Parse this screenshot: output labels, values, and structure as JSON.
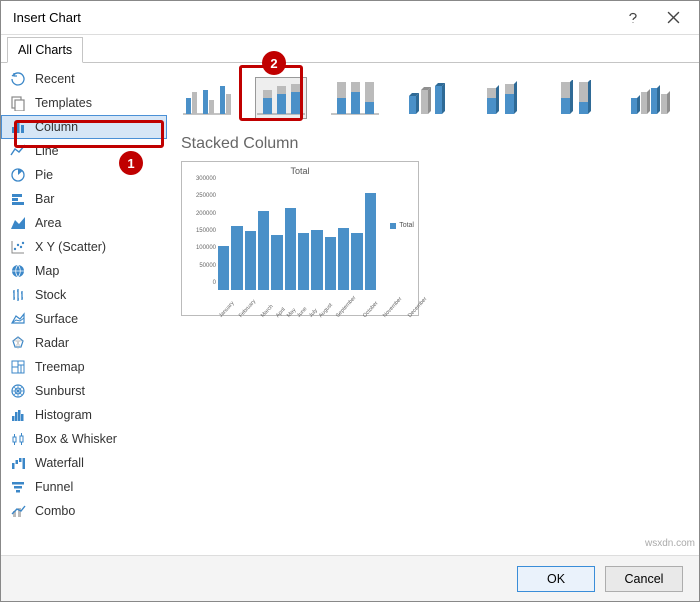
{
  "window": {
    "title": "Insert Chart",
    "help": "?",
    "close": "×"
  },
  "tabs": {
    "all": "All Charts"
  },
  "sidebar": {
    "items": [
      {
        "icon": "recent",
        "label": "Recent"
      },
      {
        "icon": "templates",
        "label": "Templates"
      },
      {
        "icon": "column",
        "label": "Column",
        "selected": true
      },
      {
        "icon": "line",
        "label": "Line"
      },
      {
        "icon": "pie",
        "label": "Pie"
      },
      {
        "icon": "bar",
        "label": "Bar"
      },
      {
        "icon": "area",
        "label": "Area"
      },
      {
        "icon": "scatter",
        "label": "X Y (Scatter)"
      },
      {
        "icon": "map",
        "label": "Map"
      },
      {
        "icon": "stock",
        "label": "Stock"
      },
      {
        "icon": "surface",
        "label": "Surface"
      },
      {
        "icon": "radar",
        "label": "Radar"
      },
      {
        "icon": "treemap",
        "label": "Treemap"
      },
      {
        "icon": "sunburst",
        "label": "Sunburst"
      },
      {
        "icon": "histogram",
        "label": "Histogram"
      },
      {
        "icon": "boxwhisker",
        "label": "Box & Whisker"
      },
      {
        "icon": "waterfall",
        "label": "Waterfall"
      },
      {
        "icon": "funnel",
        "label": "Funnel"
      },
      {
        "icon": "combo",
        "label": "Combo"
      }
    ]
  },
  "subtypes": {
    "selectedIndex": 1,
    "list": [
      "clustered-column",
      "stacked-column",
      "100-stacked-column",
      "3d-clustered-column",
      "3d-stacked-column",
      "3d-100-stacked-column",
      "3d-column"
    ]
  },
  "selection_name": "Stacked Column",
  "preview": {
    "title": "Total",
    "legend": "Total"
  },
  "chart_data": {
    "type": "bar",
    "title": "Total",
    "categories": [
      "January",
      "February",
      "March",
      "April",
      "May",
      "June",
      "July",
      "August",
      "September",
      "October",
      "November",
      "December"
    ],
    "series": [
      {
        "name": "Total",
        "values": [
          120000,
          175000,
          160000,
          215000,
          150000,
          225000,
          155000,
          165000,
          145000,
          170000,
          155000,
          265000
        ]
      }
    ],
    "ylabel": "",
    "xlabel": "",
    "ylim": [
      0,
      300000
    ],
    "yticks": [
      0,
      50000,
      100000,
      150000,
      200000,
      250000,
      300000
    ]
  },
  "actions": {
    "ok": "OK",
    "cancel": "Cancel"
  },
  "callouts": {
    "b1": "1",
    "b2": "2"
  },
  "watermark": "wsxdn.com"
}
